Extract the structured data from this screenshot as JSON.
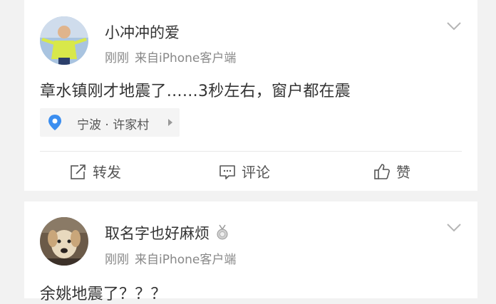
{
  "posts": [
    {
      "username": "小冲冲的爱",
      "time": "刚刚",
      "source": "来自iPhone客户端",
      "text": "章水镇刚才地震了……3秒左右，窗户都在震",
      "location": "宁波 · 许家村",
      "actions": {
        "repost": "转发",
        "comment": "评论",
        "like": "赞"
      }
    },
    {
      "username": "取名字也好麻烦",
      "time": "刚刚",
      "source": "来自iPhone客户端",
      "text": "余姚地震了？？？"
    }
  ],
  "colors": {
    "background": "#f2f2f2",
    "card": "#ffffff",
    "meta_text": "#888888",
    "location_pin": "#3b8ef0"
  },
  "icons": [
    "chevron-down-icon",
    "location-pin-icon",
    "caret-right-icon",
    "repost-icon",
    "comment-icon",
    "like-icon",
    "medal-icon"
  ]
}
